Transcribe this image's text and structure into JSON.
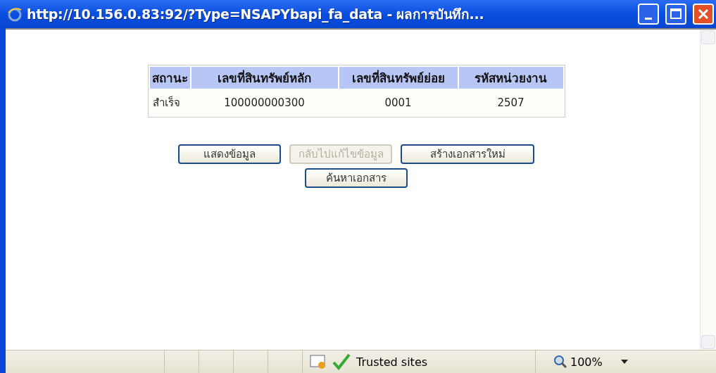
{
  "window": {
    "title": "http://10.156.0.83:92/?Type=NSAPYbapi_fa_data - ผลการบันทึก..."
  },
  "table": {
    "columns": [
      "สถานะ",
      "เลขที่สินทรัพย์หลัก",
      "เลขที่สินทรัพย์ย่อย",
      "รหัสหน่วยงาน"
    ],
    "rows": [
      [
        "สำเร็จ",
        "100000000300",
        "0001",
        "2507"
      ]
    ]
  },
  "buttons": [
    {
      "label": "แสดงข้อมูล",
      "disabled": false
    },
    {
      "label": "กลับไปแก้ไขข้อมูล",
      "disabled": true
    },
    {
      "label": "สร้างเอกสารใหม่",
      "disabled": false
    },
    {
      "label": "ค้นหาเอกสาร",
      "disabled": false
    }
  ],
  "status_bar": {
    "zone": "Trusted sites",
    "zoom": "100%"
  }
}
